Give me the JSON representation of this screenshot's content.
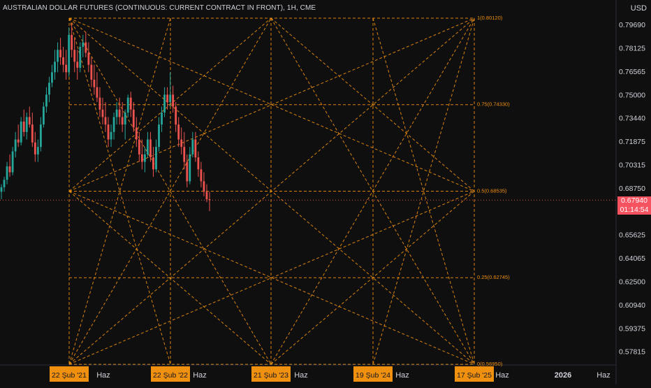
{
  "header": {
    "title": "AUSTRALIAN DOLLAR FUTURES (CONTINUOUS: CURRENT CONTRACT IN FRONT), 1H, CME"
  },
  "price_axis": {
    "currency": "USD",
    "ticks": [
      "0.79690",
      "0.78125",
      "0.76565",
      "0.75000",
      "0.73440",
      "0.71875",
      "0.70315",
      "0.68750",
      "0.65625",
      "0.64065",
      "0.62500",
      "0.60940",
      "0.59375",
      "0.57815"
    ],
    "current_price": "0.67940",
    "countdown": "01:14:54"
  },
  "time_axis": {
    "labels": [
      {
        "text": "Haz"
      },
      {
        "text": "Haz"
      },
      {
        "text": "Haz"
      },
      {
        "text": "Haz"
      },
      {
        "text": "Haz"
      },
      {
        "text": "2026"
      },
      {
        "text": "Haz"
      }
    ],
    "highlighted": [
      {
        "text": "22 Şub '21"
      },
      {
        "text": "22 Şub '22"
      },
      {
        "text": "21 Şub '23"
      },
      {
        "text": "19 Şub '24"
      },
      {
        "text": "17 Şub '25"
      }
    ]
  },
  "colors": {
    "background": "#0f0f0f",
    "up": "#26a69a",
    "down": "#ef5350",
    "gann": "#f0900f",
    "price_tag": "#f7525f",
    "axis_text": "#d1d4dc"
  },
  "chart_data": {
    "type": "candlestick",
    "title": "AUSTRALIAN DOLLAR FUTURES (CONTINUOUS: CURRENT CONTRACT IN FRONT), 1H, CME",
    "ylabel": "USD",
    "ylim": [
      0.57,
      0.804
    ],
    "current_price": 0.6794,
    "gann_box": {
      "start": "22 Şub '21",
      "end": "17 Şub '25",
      "levels": [
        {
          "label": "1(0.80120)",
          "value": 0.8012
        },
        {
          "label": "0.75(0.74330)",
          "value": 0.7433
        },
        {
          "label": "0.5(0.68535)",
          "value": 0.68535
        },
        {
          "label": "0.25(0.62745)",
          "value": 0.62745
        },
        {
          "label": "0(0.56950)",
          "value": 0.5695
        }
      ]
    },
    "candles": [
      [
        0.685,
        0.69,
        0.68,
        0.688
      ],
      [
        0.688,
        0.695,
        0.685,
        0.693
      ],
      [
        0.693,
        0.705,
        0.69,
        0.702
      ],
      [
        0.702,
        0.71,
        0.695,
        0.698
      ],
      [
        0.698,
        0.715,
        0.696,
        0.712
      ],
      [
        0.712,
        0.725,
        0.708,
        0.72
      ],
      [
        0.72,
        0.73,
        0.715,
        0.718
      ],
      [
        0.718,
        0.735,
        0.716,
        0.732
      ],
      [
        0.732,
        0.74,
        0.722,
        0.725
      ],
      [
        0.725,
        0.738,
        0.72,
        0.735
      ],
      [
        0.735,
        0.742,
        0.728,
        0.73
      ],
      [
        0.73,
        0.738,
        0.715,
        0.718
      ],
      [
        0.718,
        0.725,
        0.705,
        0.71
      ],
      [
        0.71,
        0.72,
        0.705,
        0.715
      ],
      [
        0.715,
        0.735,
        0.712,
        0.73
      ],
      [
        0.73,
        0.745,
        0.728,
        0.742
      ],
      [
        0.742,
        0.755,
        0.738,
        0.75
      ],
      [
        0.75,
        0.762,
        0.745,
        0.758
      ],
      [
        0.758,
        0.77,
        0.755,
        0.765
      ],
      [
        0.765,
        0.78,
        0.76,
        0.772
      ],
      [
        0.772,
        0.785,
        0.765,
        0.78
      ],
      [
        0.78,
        0.788,
        0.77,
        0.775
      ],
      [
        0.775,
        0.782,
        0.765,
        0.77
      ],
      [
        0.77,
        0.78,
        0.76,
        0.765
      ],
      [
        0.765,
        0.795,
        0.762,
        0.79
      ],
      [
        0.79,
        0.798,
        0.775,
        0.78
      ],
      [
        0.78,
        0.788,
        0.765,
        0.772
      ],
      [
        0.772,
        0.78,
        0.76,
        0.768
      ],
      [
        0.768,
        0.785,
        0.765,
        0.782
      ],
      [
        0.782,
        0.79,
        0.775,
        0.785
      ],
      [
        0.785,
        0.792,
        0.775,
        0.778
      ],
      [
        0.778,
        0.785,
        0.765,
        0.77
      ],
      [
        0.77,
        0.775,
        0.755,
        0.76
      ],
      [
        0.76,
        0.77,
        0.75,
        0.755
      ],
      [
        0.755,
        0.765,
        0.745,
        0.748
      ],
      [
        0.748,
        0.755,
        0.735,
        0.74
      ],
      [
        0.74,
        0.748,
        0.73,
        0.735
      ],
      [
        0.735,
        0.745,
        0.725,
        0.73
      ],
      [
        0.73,
        0.735,
        0.715,
        0.72
      ],
      [
        0.72,
        0.73,
        0.715,
        0.725
      ],
      [
        0.725,
        0.738,
        0.72,
        0.735
      ],
      [
        0.735,
        0.745,
        0.73,
        0.74
      ],
      [
        0.74,
        0.748,
        0.73,
        0.735
      ],
      [
        0.735,
        0.745,
        0.725,
        0.73
      ],
      [
        0.73,
        0.74,
        0.72,
        0.738
      ],
      [
        0.738,
        0.75,
        0.735,
        0.748
      ],
      [
        0.748,
        0.752,
        0.735,
        0.74
      ],
      [
        0.74,
        0.745,
        0.725,
        0.728
      ],
      [
        0.728,
        0.735,
        0.715,
        0.72
      ],
      [
        0.72,
        0.725,
        0.705,
        0.71
      ],
      [
        0.71,
        0.72,
        0.7,
        0.705
      ],
      [
        0.705,
        0.715,
        0.698,
        0.71
      ],
      [
        0.71,
        0.725,
        0.708,
        0.72
      ],
      [
        0.72,
        0.725,
        0.705,
        0.708
      ],
      [
        0.708,
        0.715,
        0.695,
        0.7
      ],
      [
        0.7,
        0.72,
        0.698,
        0.715
      ],
      [
        0.715,
        0.735,
        0.712,
        0.73
      ],
      [
        0.73,
        0.742,
        0.725,
        0.738
      ],
      [
        0.738,
        0.755,
        0.735,
        0.75
      ],
      [
        0.75,
        0.755,
        0.74,
        0.745
      ],
      [
        0.745,
        0.765,
        0.742,
        0.75
      ],
      [
        0.75,
        0.756,
        0.738,
        0.742
      ],
      [
        0.742,
        0.745,
        0.725,
        0.73
      ],
      [
        0.73,
        0.735,
        0.715,
        0.72
      ],
      [
        0.72,
        0.728,
        0.71,
        0.715
      ],
      [
        0.715,
        0.725,
        0.7,
        0.705
      ],
      [
        0.705,
        0.71,
        0.688,
        0.692
      ],
      [
        0.692,
        0.715,
        0.69,
        0.71
      ],
      [
        0.71,
        0.725,
        0.708,
        0.72
      ],
      [
        0.72,
        0.725,
        0.705,
        0.708
      ],
      [
        0.708,
        0.712,
        0.695,
        0.7
      ],
      [
        0.7,
        0.705,
        0.688,
        0.692
      ],
      [
        0.692,
        0.698,
        0.682,
        0.685
      ],
      [
        0.685,
        0.69,
        0.678,
        0.68
      ],
      [
        0.68,
        0.685,
        0.672,
        0.6794
      ]
    ]
  }
}
